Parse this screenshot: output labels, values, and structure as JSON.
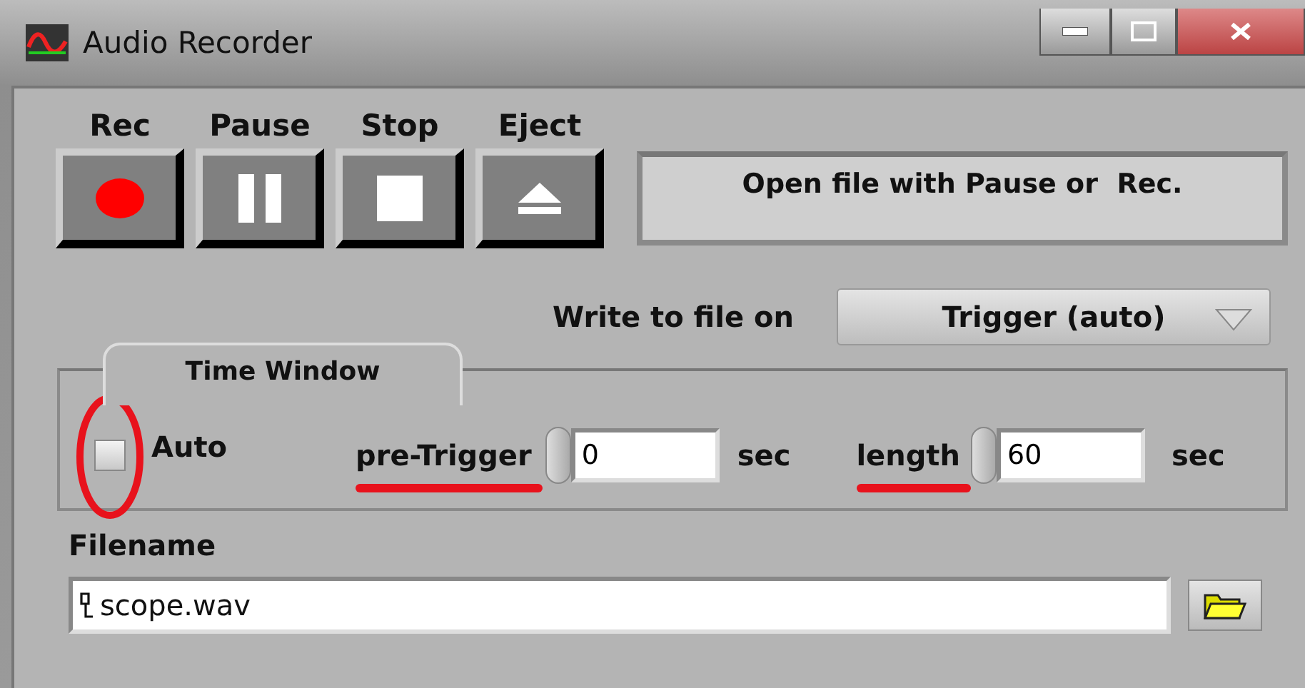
{
  "window": {
    "title": "Audio Recorder"
  },
  "transport_buttons": [
    {
      "label": "Rec",
      "kind": "record"
    },
    {
      "label": "Pause",
      "kind": "pause"
    },
    {
      "label": "Stop",
      "kind": "stop"
    },
    {
      "label": "Eject",
      "kind": "eject"
    }
  ],
  "status_message": "Open file with Pause or  Rec.",
  "write_mode": {
    "label": "Write to file on",
    "value": "Trigger (auto)"
  },
  "time_window": {
    "title": "Time Window",
    "auto": {
      "label": "Auto",
      "checked": false
    },
    "pre_trigger": {
      "label": "pre-Trigger",
      "value": "0",
      "unit": "sec"
    },
    "length": {
      "label": "length",
      "value": "60",
      "unit": "sec"
    }
  },
  "filename": {
    "label": "Filename",
    "value": "scope.wav"
  }
}
